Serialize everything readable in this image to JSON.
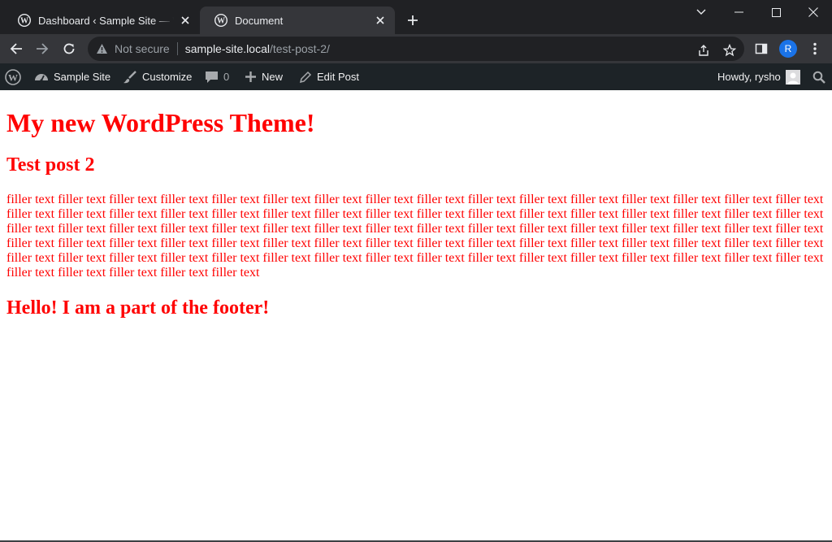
{
  "browser": {
    "tabs": [
      {
        "title": "Dashboard ‹ Sample Site — WordPress",
        "icon": "wordpress-icon",
        "active": false
      },
      {
        "title": "Document",
        "icon": "wordpress-icon",
        "active": true
      }
    ],
    "address_bar": {
      "security_label": "Not secure",
      "host": "sample-site.local",
      "path": "/test-post-2/"
    },
    "profile_initial": "R"
  },
  "admin_bar": {
    "site_name": "Sample Site",
    "customize_label": "Customize",
    "comments_count": "0",
    "new_label": "New",
    "edit_post_label": "Edit Post",
    "greeting": "Howdy, rysho"
  },
  "page": {
    "site_title": "My new WordPress Theme!",
    "post_title": "Test post 2",
    "post_body": "filler text filler text filler text filler text filler text filler text filler text filler text filler text filler text filler text filler text filler text filler text filler text filler text filler text filler text filler text filler text filler text filler text filler text filler text filler text filler text filler text filler text filler text filler text filler text filler text filler text filler text filler text filler text filler text filler text filler text filler text filler text filler text filler text filler text filler text filler text filler text filler text filler text filler text filler text filler text filler text filler text filler text filler text filler text filler text filler text filler text filler text filler text filler text filler text filler text filler text filler text filler text filler text filler text filler text filler text filler text filler text filler text filler text filler text filler text filler text filler text filler text filler text filler text filler text filler text",
    "footer_text": "Hello! I am a part of the footer!"
  },
  "colors": {
    "page_text": "#ff0000",
    "tabstrip_bg": "#202124",
    "toolbar_bg": "#35363a",
    "adminbar_bg": "#1d2327",
    "profile_bg": "#1a73e8"
  }
}
